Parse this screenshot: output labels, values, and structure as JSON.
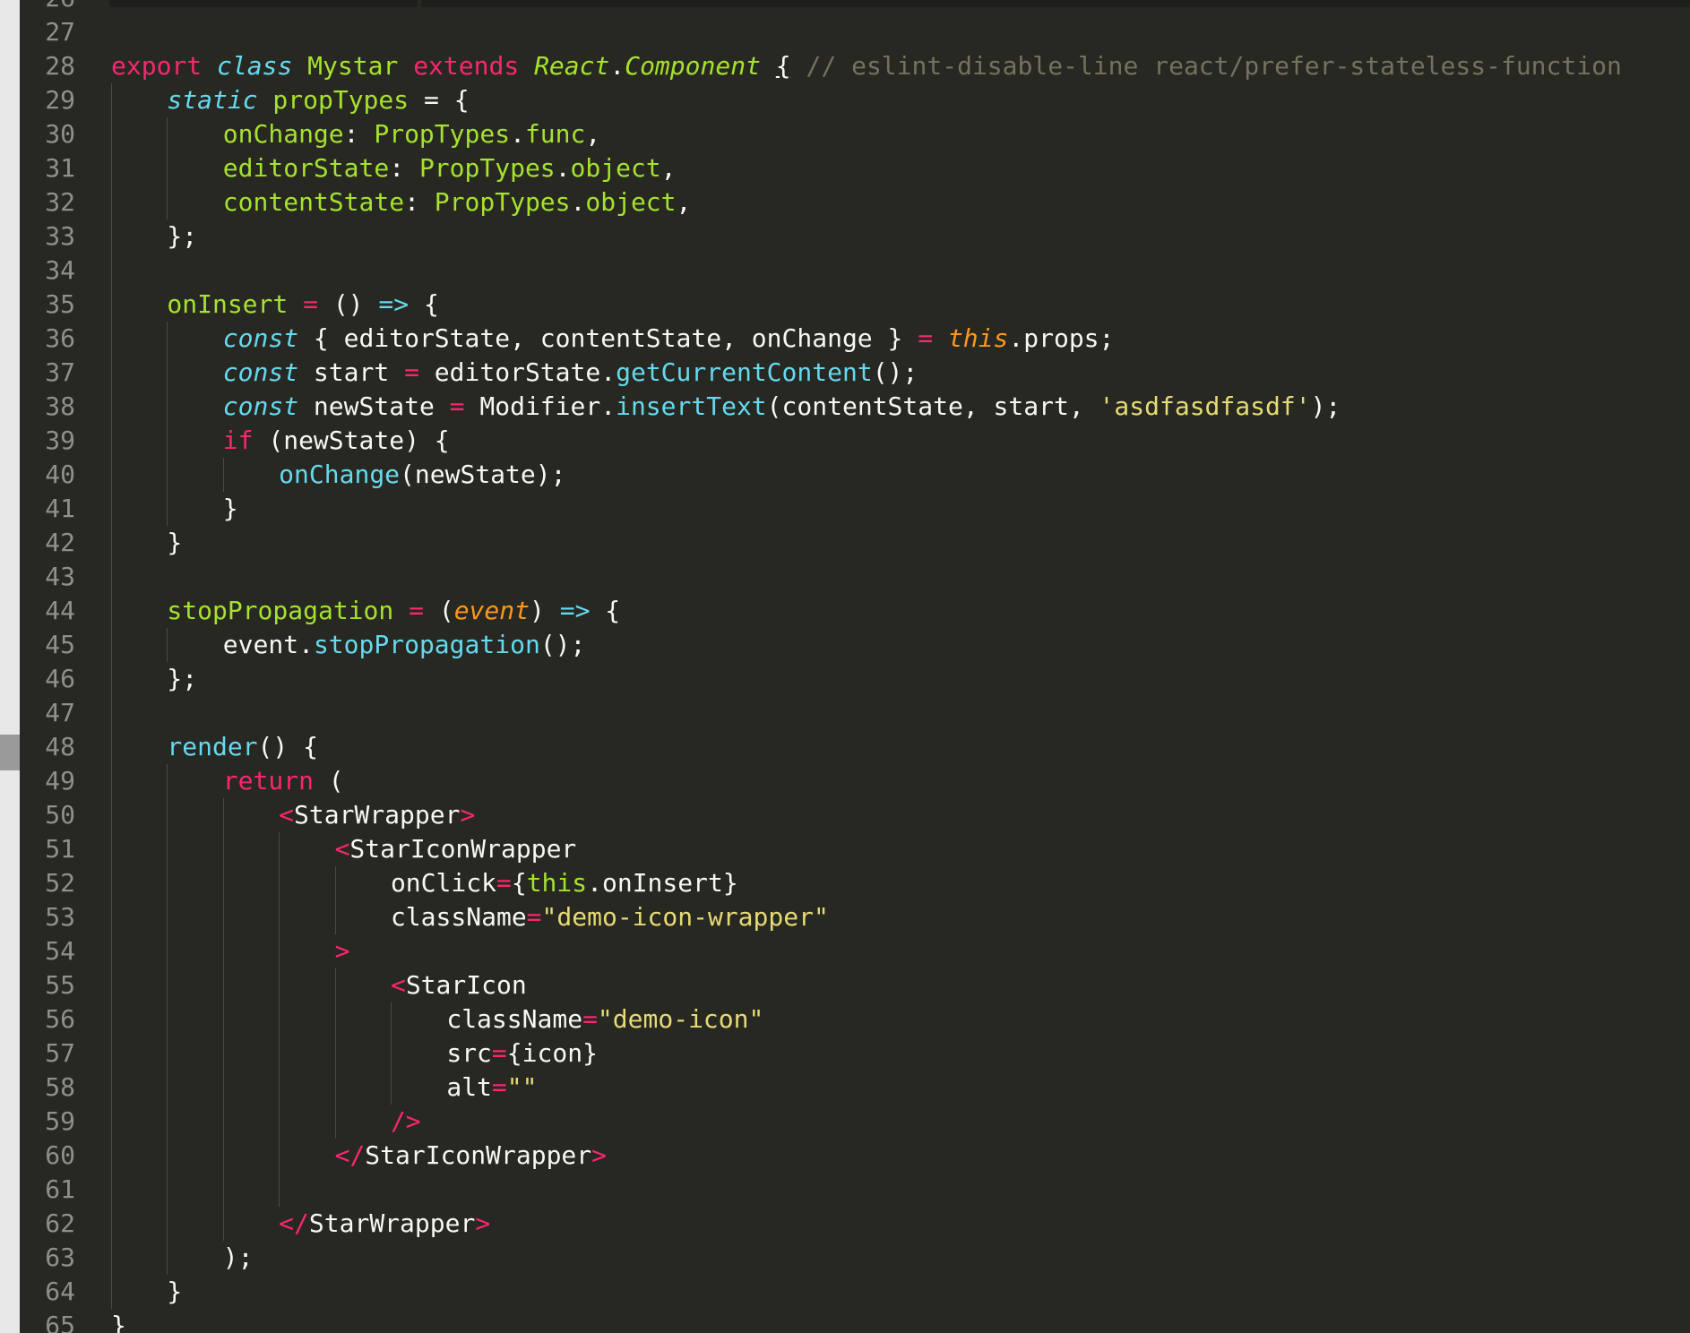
{
  "editor": {
    "language": "JavaScript (JSX)",
    "theme": "Monokai",
    "colors": {
      "background": "#272822",
      "keyword": "#f92672",
      "storage": "#66d9ef",
      "entity": "#a6e22e",
      "string": "#e6db74",
      "comment": "#75715e",
      "parameter": "#fd971f",
      "foreground": "#f8f8f2",
      "line_number": "#8f908a"
    },
    "first_partial_line": "26",
    "last_partial_line": "65",
    "lines": [
      {
        "n": "27",
        "tokens": []
      },
      {
        "n": "28",
        "tokens": [
          [
            "kw",
            "export"
          ],
          [
            "pl",
            " "
          ],
          [
            "st",
            "class"
          ],
          [
            "pl",
            " "
          ],
          [
            "cn",
            "Mystar"
          ],
          [
            "pl",
            " "
          ],
          [
            "kw",
            "extends"
          ],
          [
            "pl",
            " "
          ],
          [
            "it",
            "React"
          ],
          [
            "pl",
            "."
          ],
          [
            "it",
            "Component"
          ],
          [
            "pl",
            " "
          ],
          [
            "ul",
            "{"
          ],
          [
            "pl",
            " "
          ],
          [
            "cm",
            "// eslint-disable-line react/prefer-stateless-function"
          ]
        ]
      },
      {
        "n": "29",
        "tokens": [
          [
            "g1",
            ""
          ],
          [
            "st",
            "static"
          ],
          [
            "pl",
            " "
          ],
          [
            "cn",
            "propTypes"
          ],
          [
            "pl",
            " = {"
          ]
        ]
      },
      {
        "n": "30",
        "tokens": [
          [
            "g2",
            ""
          ],
          [
            "cn",
            "onChange"
          ],
          [
            "pl",
            ": "
          ],
          [
            "cn",
            "PropTypes"
          ],
          [
            "pl",
            "."
          ],
          [
            "cn",
            "func"
          ],
          [
            "pl",
            ","
          ]
        ]
      },
      {
        "n": "31",
        "tokens": [
          [
            "g2",
            ""
          ],
          [
            "cn",
            "editorState"
          ],
          [
            "pl",
            ": "
          ],
          [
            "cn",
            "PropTypes"
          ],
          [
            "pl",
            "."
          ],
          [
            "cn",
            "object"
          ],
          [
            "pl",
            ","
          ]
        ]
      },
      {
        "n": "32",
        "tokens": [
          [
            "g2",
            ""
          ],
          [
            "cn",
            "contentState"
          ],
          [
            "pl",
            ": "
          ],
          [
            "cn",
            "PropTypes"
          ],
          [
            "pl",
            "."
          ],
          [
            "cn",
            "object"
          ],
          [
            "pl",
            ","
          ]
        ]
      },
      {
        "n": "33",
        "tokens": [
          [
            "g1",
            ""
          ],
          [
            "pl",
            "};"
          ]
        ]
      },
      {
        "n": "34",
        "tokens": [
          [
            "g1",
            ""
          ]
        ]
      },
      {
        "n": "35",
        "tokens": [
          [
            "g1",
            ""
          ],
          [
            "cn",
            "onInsert"
          ],
          [
            "pl",
            " "
          ],
          [
            "kw",
            "="
          ],
          [
            "pl",
            " () "
          ],
          [
            "fn",
            "=>"
          ],
          [
            "pl",
            " {"
          ]
        ]
      },
      {
        "n": "36",
        "tokens": [
          [
            "g2",
            ""
          ],
          [
            "st",
            "const"
          ],
          [
            "pl",
            " { editorState, contentState, onChange } "
          ],
          [
            "kw",
            "="
          ],
          [
            "pl",
            " "
          ],
          [
            "th",
            "this"
          ],
          [
            "pl",
            ".props;"
          ]
        ]
      },
      {
        "n": "37",
        "tokens": [
          [
            "g2",
            ""
          ],
          [
            "st",
            "const"
          ],
          [
            "pl",
            " start "
          ],
          [
            "kw",
            "="
          ],
          [
            "pl",
            " editorState."
          ],
          [
            "fn",
            "getCurrentContent"
          ],
          [
            "pl",
            "();"
          ]
        ]
      },
      {
        "n": "38",
        "tokens": [
          [
            "g2",
            ""
          ],
          [
            "st",
            "const"
          ],
          [
            "pl",
            " newState "
          ],
          [
            "kw",
            "="
          ],
          [
            "pl",
            " Modifier."
          ],
          [
            "fn",
            "insertText"
          ],
          [
            "pl",
            "(contentState, start, "
          ],
          [
            "str",
            "'asdfasdfasdf'"
          ],
          [
            "pl",
            ");"
          ]
        ]
      },
      {
        "n": "39",
        "tokens": [
          [
            "g2",
            ""
          ],
          [
            "kw",
            "if"
          ],
          [
            "pl",
            " (newState) {"
          ]
        ]
      },
      {
        "n": "40",
        "tokens": [
          [
            "g3",
            ""
          ],
          [
            "fn",
            "onChange"
          ],
          [
            "pl",
            "(newState);"
          ]
        ]
      },
      {
        "n": "41",
        "tokens": [
          [
            "g2",
            ""
          ],
          [
            "pl",
            "}"
          ]
        ]
      },
      {
        "n": "42",
        "tokens": [
          [
            "g1",
            ""
          ],
          [
            "pl",
            "}"
          ]
        ]
      },
      {
        "n": "43",
        "tokens": [
          [
            "g1",
            ""
          ]
        ]
      },
      {
        "n": "44",
        "tokens": [
          [
            "g1",
            ""
          ],
          [
            "cn",
            "stopPropagation"
          ],
          [
            "pl",
            " "
          ],
          [
            "kw",
            "="
          ],
          [
            "pl",
            " ("
          ],
          [
            "pm",
            "event"
          ],
          [
            "pl",
            ") "
          ],
          [
            "fn",
            "=>"
          ],
          [
            "pl",
            " {"
          ]
        ]
      },
      {
        "n": "45",
        "tokens": [
          [
            "g2",
            ""
          ],
          [
            "pl",
            "event."
          ],
          [
            "fn",
            "stopPropagation"
          ],
          [
            "pl",
            "();"
          ]
        ]
      },
      {
        "n": "46",
        "tokens": [
          [
            "g1",
            ""
          ],
          [
            "pl",
            "};"
          ]
        ]
      },
      {
        "n": "47",
        "tokens": [
          [
            "g1",
            ""
          ]
        ]
      },
      {
        "n": "48",
        "tokens": [
          [
            "g1",
            ""
          ],
          [
            "fn",
            "render"
          ],
          [
            "pl",
            "() {"
          ]
        ]
      },
      {
        "n": "49",
        "tokens": [
          [
            "g2",
            ""
          ],
          [
            "kw",
            "return"
          ],
          [
            "pl",
            " ("
          ]
        ]
      },
      {
        "n": "50",
        "tokens": [
          [
            "g3",
            ""
          ],
          [
            "tg",
            "<"
          ],
          [
            "pl",
            "StarWrapper"
          ],
          [
            "tg",
            ">"
          ]
        ]
      },
      {
        "n": "51",
        "tokens": [
          [
            "g4",
            ""
          ],
          [
            "tg",
            "<"
          ],
          [
            "pl",
            "StarIconWrapper"
          ]
        ]
      },
      {
        "n": "52",
        "tokens": [
          [
            "g5",
            ""
          ],
          [
            "pl",
            "onClick"
          ],
          [
            "kw",
            "="
          ],
          [
            "pl",
            "{"
          ],
          [
            "tv",
            "this"
          ],
          [
            "pl",
            ".onInsert}"
          ]
        ]
      },
      {
        "n": "53",
        "tokens": [
          [
            "g5",
            ""
          ],
          [
            "pl",
            "className"
          ],
          [
            "kw",
            "="
          ],
          [
            "str",
            "\"demo-icon-wrapper\""
          ]
        ]
      },
      {
        "n": "54",
        "tokens": [
          [
            "g4",
            ""
          ],
          [
            "tg",
            ">"
          ]
        ]
      },
      {
        "n": "55",
        "tokens": [
          [
            "g5",
            ""
          ],
          [
            "tg",
            "<"
          ],
          [
            "pl",
            "StarIcon"
          ]
        ]
      },
      {
        "n": "56",
        "tokens": [
          [
            "g6",
            ""
          ],
          [
            "pl",
            "className"
          ],
          [
            "kw",
            "="
          ],
          [
            "str",
            "\"demo-icon\""
          ]
        ]
      },
      {
        "n": "57",
        "tokens": [
          [
            "g6",
            ""
          ],
          [
            "pl",
            "src"
          ],
          [
            "kw",
            "="
          ],
          [
            "pl",
            "{icon}"
          ]
        ]
      },
      {
        "n": "58",
        "tokens": [
          [
            "g6",
            ""
          ],
          [
            "pl",
            "alt"
          ],
          [
            "kw",
            "="
          ],
          [
            "str",
            "\"\""
          ]
        ]
      },
      {
        "n": "59",
        "tokens": [
          [
            "g5",
            ""
          ],
          [
            "tg",
            "/>"
          ]
        ]
      },
      {
        "n": "60",
        "tokens": [
          [
            "g4",
            ""
          ],
          [
            "tg",
            "</"
          ],
          [
            "pl",
            "StarIconWrapper"
          ],
          [
            "tg",
            ">"
          ]
        ]
      },
      {
        "n": "61",
        "tokens": [
          [
            "g4",
            ""
          ]
        ]
      },
      {
        "n": "62",
        "tokens": [
          [
            "g3",
            ""
          ],
          [
            "tg",
            "</"
          ],
          [
            "pl",
            "StarWrapper"
          ],
          [
            "tg",
            ">"
          ]
        ]
      },
      {
        "n": "63",
        "tokens": [
          [
            "g2",
            ""
          ],
          [
            "pl",
            ");"
          ]
        ]
      },
      {
        "n": "64",
        "tokens": [
          [
            "g1",
            ""
          ],
          [
            "pl",
            "}"
          ]
        ]
      },
      {
        "n": "65",
        "tokens": [
          [
            "pl",
            "}"
          ]
        ]
      }
    ]
  }
}
